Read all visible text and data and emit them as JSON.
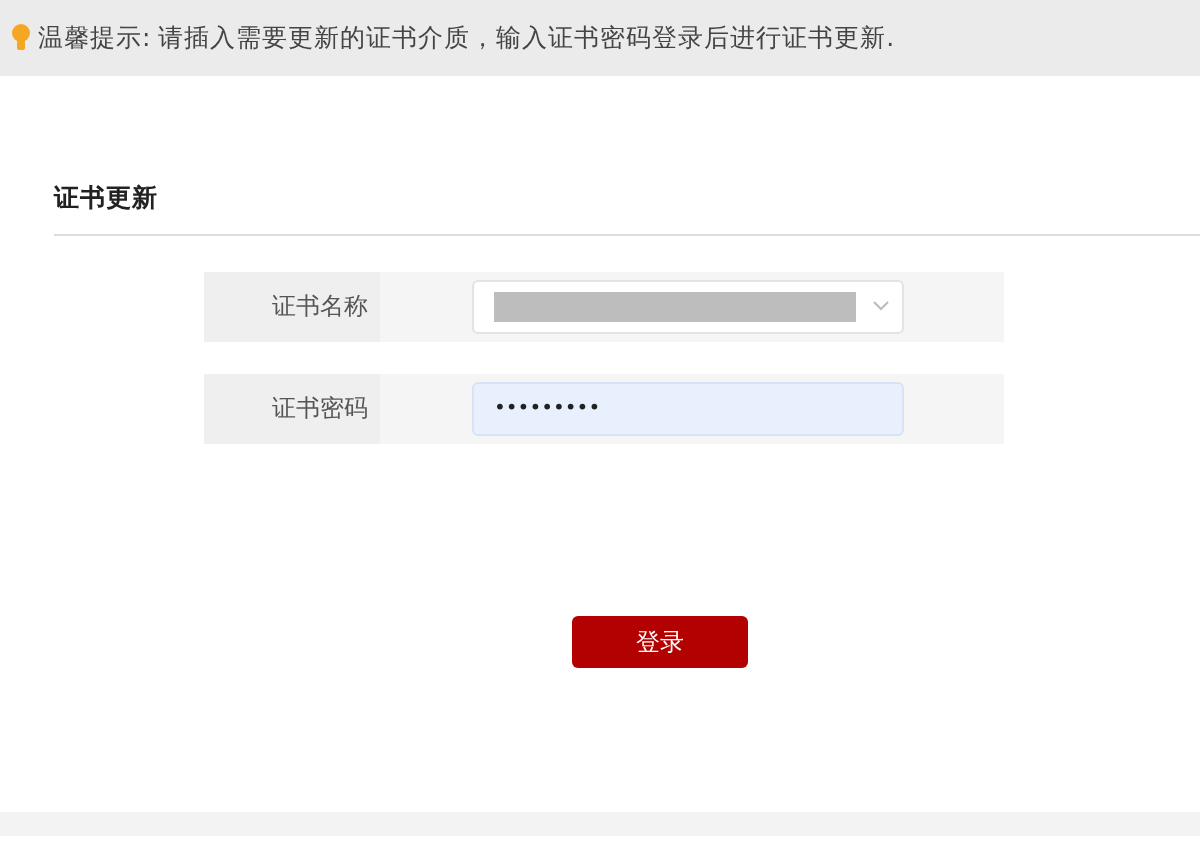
{
  "tip": {
    "text": "温馨提示: 请插入需要更新的证书介质，输入证书密码登录后进行证书更新."
  },
  "section": {
    "title": "证书更新"
  },
  "fields": [
    {
      "kind": "select",
      "label": "证书名称",
      "redacted": true
    },
    {
      "kind": "password",
      "label": "证书密码",
      "value": "•••••••••",
      "focused": true
    }
  ],
  "button": {
    "label": "登录"
  }
}
